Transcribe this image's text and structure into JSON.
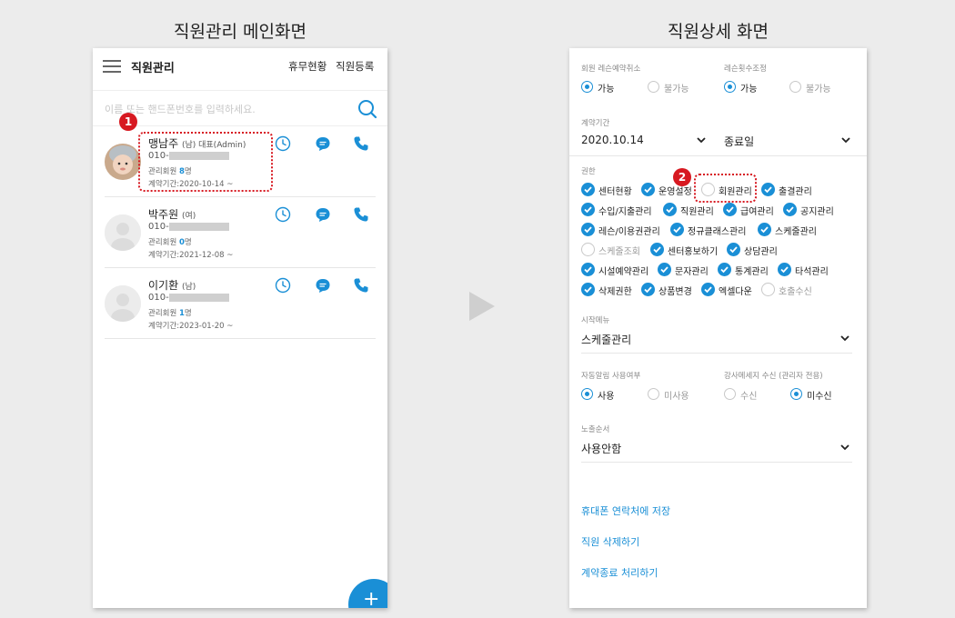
{
  "captions": {
    "main": "직원관리 메인화면",
    "detail": "직원상세 화면"
  },
  "main_screen": {
    "title": "직원관리",
    "links": {
      "leave": "휴무현황",
      "register": "직원등록"
    },
    "search": {
      "placeholder": "이름 또는 핸드폰번호를 입력하세요."
    },
    "staff": [
      {
        "name": "맹남주",
        "meta": "(남) 대표(Admin)",
        "phone_prefix": "010-",
        "managed_prefix": "관리회원 ",
        "managed_count": "8",
        "managed_suffix": "명",
        "contract": "계약기간:2020-10-14 ~",
        "has_photo": true
      },
      {
        "name": "박주원",
        "meta": "(여)",
        "phone_prefix": "010-",
        "managed_prefix": "관리회원 ",
        "managed_count": "0",
        "managed_suffix": "명",
        "contract": "계약기간:2021-12-08 ~",
        "has_photo": false
      },
      {
        "name": "이기환",
        "meta": "(남)",
        "phone_prefix": "010-",
        "managed_prefix": "관리회원 ",
        "managed_count": "1",
        "managed_suffix": "명",
        "contract": "계약기간:2023-01-20 ~",
        "has_photo": false
      }
    ],
    "fab_label": "+",
    "badge": "1"
  },
  "detail_screen": {
    "cancel_booking": {
      "label": "회원 레슨예약취소",
      "options": [
        "가능",
        "불가능"
      ],
      "selected": "가능"
    },
    "adjust_count": {
      "label": "레슨횟수조정",
      "options": [
        "가능",
        "불가능"
      ],
      "selected": "가능"
    },
    "contract": {
      "label": "계약기간",
      "start": "2020.10.14",
      "end": "종료일"
    },
    "permissions": {
      "label": "권한",
      "items": [
        {
          "label": "센터현황",
          "checked": true
        },
        {
          "label": "운영설정",
          "checked": true
        },
        {
          "label": "회원관리",
          "checked": false
        },
        {
          "label": "출결관리",
          "checked": true
        },
        {
          "label": "수입/지출관리",
          "checked": true
        },
        {
          "label": "직원관리",
          "checked": true
        },
        {
          "label": "급여관리",
          "checked": true
        },
        {
          "label": "공지관리",
          "checked": true
        },
        {
          "label": "레슨/이용권관리",
          "checked": true
        },
        {
          "label": "정규클래스관리",
          "checked": true
        },
        {
          "label": "스케줄관리",
          "checked": true
        },
        {
          "label": "스케줄조회",
          "checked": false
        },
        {
          "label": "센터홍보하기",
          "checked": true
        },
        {
          "label": "상담관리",
          "checked": true
        },
        {
          "label": "시설예약관리",
          "checked": true
        },
        {
          "label": "문자관리",
          "checked": true
        },
        {
          "label": "통계관리",
          "checked": true
        },
        {
          "label": "타석관리",
          "checked": true
        },
        {
          "label": "삭제권한",
          "checked": true
        },
        {
          "label": "상품변경",
          "checked": true
        },
        {
          "label": "엑셀다운",
          "checked": true
        },
        {
          "label": "호출수신",
          "checked": false
        }
      ]
    },
    "start_menu": {
      "label": "시작메뉴",
      "value": "스케줄관리"
    },
    "auto_alert": {
      "label": "자동알림 사용여부",
      "options": [
        "사용",
        "미사용"
      ],
      "selected": "사용"
    },
    "instructor_msg": {
      "label": "강사메세지 수신 (관리자 전용)",
      "options": [
        "수신",
        "미수신"
      ],
      "selected": "미수신"
    },
    "display_order": {
      "label": "노출순서",
      "value": "사용안함"
    },
    "actions": [
      "휴대폰 연락처에 저장",
      "직원 삭제하기",
      "계약종료 처리하기"
    ],
    "badge": "2"
  },
  "colors": {
    "accent": "#1a8fd6",
    "highlight": "#d71921"
  },
  "icons": [
    "menu-icon",
    "search-icon",
    "clock-icon",
    "chat-icon",
    "phone-icon",
    "plus-icon",
    "chevron-down-icon",
    "check-icon"
  ]
}
